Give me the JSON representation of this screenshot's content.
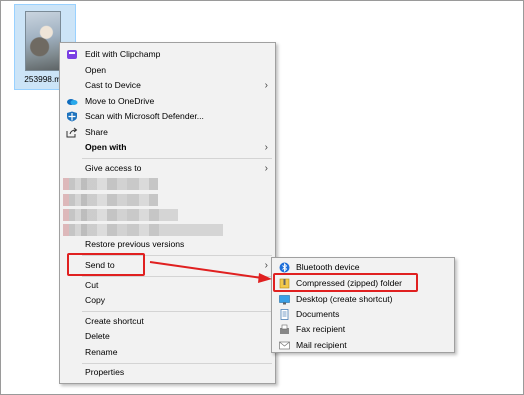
{
  "desktop": {
    "file_name": "253998.mp"
  },
  "context_menu": {
    "items": [
      {
        "label": "Edit with Clipchamp",
        "icon": "clipchamp-icon"
      },
      {
        "label": "Open"
      },
      {
        "label": "Cast to Device"
      },
      {
        "label": "Move to OneDrive",
        "icon": "onedrive-icon"
      },
      {
        "label": "Scan with Microsoft Defender...",
        "icon": "defender-icon"
      },
      {
        "label": "Share",
        "icon": "share-icon"
      },
      {
        "label": "Open with"
      },
      {
        "label": "Give access to"
      },
      {
        "label": "Restore previous versions"
      },
      {
        "label": "Send to"
      },
      {
        "label": "Cut"
      },
      {
        "label": "Copy"
      },
      {
        "label": "Create shortcut"
      },
      {
        "label": "Delete"
      },
      {
        "label": "Rename"
      },
      {
        "label": "Properties"
      }
    ]
  },
  "send_to_menu": {
    "items": [
      {
        "label": "Bluetooth device",
        "icon": "bluetooth-icon"
      },
      {
        "label": "Compressed (zipped) folder",
        "icon": "zip-folder-icon"
      },
      {
        "label": "Desktop (create shortcut)",
        "icon": "desktop-icon"
      },
      {
        "label": "Documents",
        "icon": "documents-icon"
      },
      {
        "label": "Fax recipient",
        "icon": "fax-icon"
      },
      {
        "label": "Mail recipient",
        "icon": "mail-icon"
      }
    ]
  },
  "colors": {
    "highlight": "#e02020",
    "menu_bg": "#f2f2f2",
    "selection": "#cce4f7"
  }
}
